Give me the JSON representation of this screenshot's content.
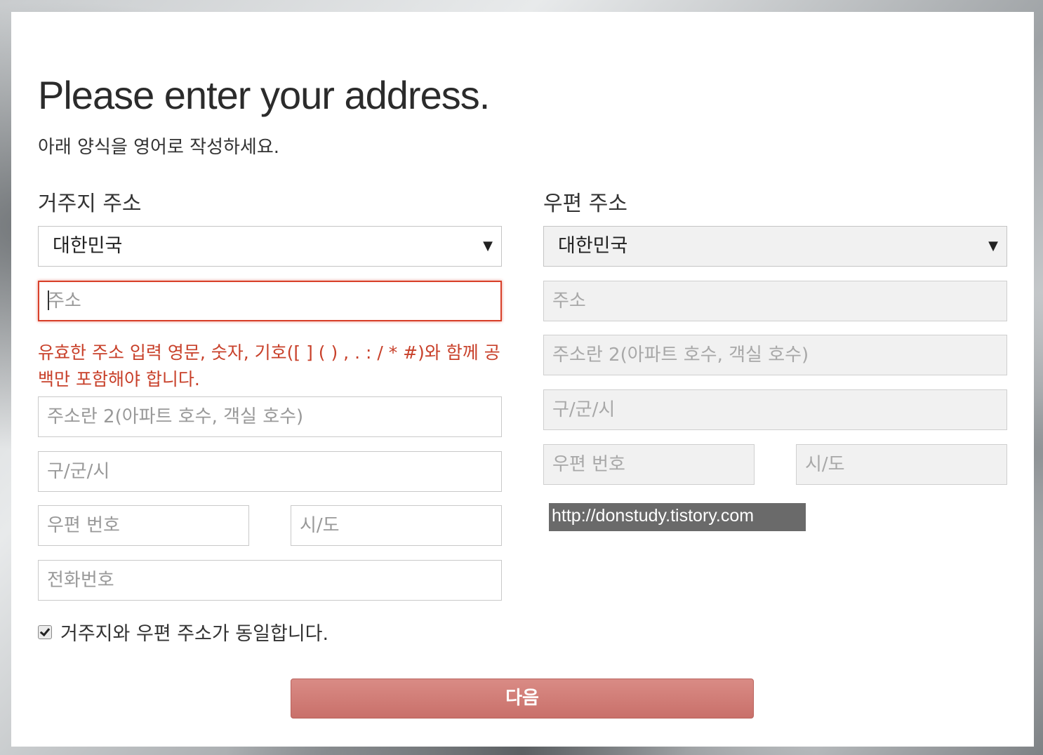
{
  "form": {
    "title": "Please enter your address.",
    "subtitle": "아래 양식을 영어로 작성하세요."
  },
  "residence": {
    "heading": "거주지 주소",
    "country": "대한민국",
    "address_placeholder": "주소",
    "error_message": "유효한 주소 입력 영문, 숫자, 기호([ ] ( ) , . : / * #)와 함께 공백만 포함해야 합니다.",
    "address2_placeholder": "주소란 2(아파트 호수, 객실 호수)",
    "city_placeholder": "구/군/시",
    "postal_placeholder": "우편 번호",
    "state_placeholder": "시/도",
    "phone_placeholder": "전화번호"
  },
  "mailing": {
    "heading": "우편 주소",
    "country": "대한민국",
    "address_placeholder": "주소",
    "address2_placeholder": "주소란 2(아파트 호수, 객실 호수)",
    "city_placeholder": "구/군/시",
    "postal_placeholder": "우편 번호",
    "state_placeholder": "시/도"
  },
  "same_address": {
    "label": "거주지와 우편 주소가 동일합니다.",
    "checked": true
  },
  "next_button": "다음",
  "watermark": "http://donstudy.tistory.com",
  "icons": {
    "select_caret": "▼"
  },
  "colors": {
    "error": "#c8402a",
    "button": "#d0796f"
  }
}
